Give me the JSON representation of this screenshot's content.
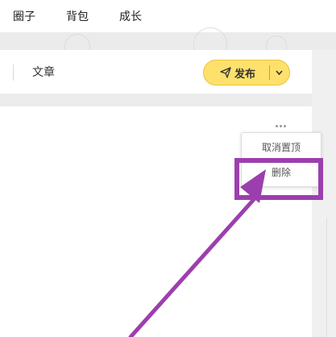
{
  "nav": {
    "items": [
      {
        "label": "圈子"
      },
      {
        "label": "背包"
      },
      {
        "label": "成长"
      }
    ]
  },
  "toolbar": {
    "tab_label": "文章",
    "publish_label": "发布",
    "publish_color": "#fde16c"
  },
  "context_menu": {
    "items": [
      {
        "label": "取消置顶"
      },
      {
        "label": "删除"
      }
    ]
  },
  "icons": {
    "publish": "send-icon",
    "publish_dropdown": "chevron-down-icon",
    "more": "more-dots-icon"
  },
  "annotation": {
    "highlight_color": "#9c3fae",
    "arrow_color": "#9c3fae"
  }
}
